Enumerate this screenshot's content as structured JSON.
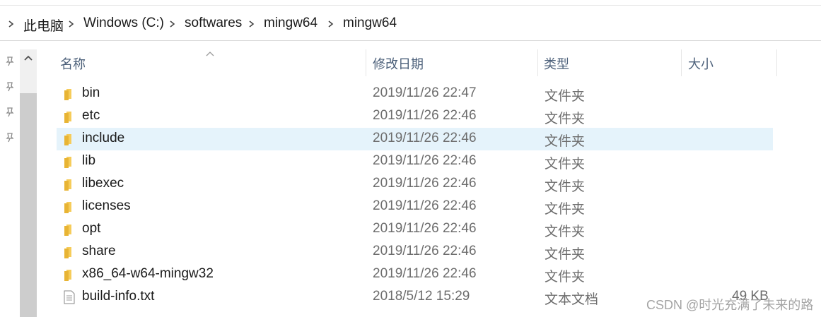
{
  "breadcrumb": {
    "items": [
      "此电脑",
      "Windows (C:)",
      "softwares",
      "mingw64",
      "mingw64"
    ]
  },
  "columns": {
    "name": "名称",
    "date": "修改日期",
    "type": "类型",
    "size": "大小"
  },
  "files": [
    {
      "name": "bin",
      "date": "2019/11/26 22:47",
      "type": "文件夹",
      "size": "",
      "icon": "folder-icon"
    },
    {
      "name": "etc",
      "date": "2019/11/26 22:46",
      "type": "文件夹",
      "size": "",
      "icon": "folder-icon"
    },
    {
      "name": "include",
      "date": "2019/11/26 22:46",
      "type": "文件夹",
      "size": "",
      "icon": "folder-icon",
      "selected": true
    },
    {
      "name": "lib",
      "date": "2019/11/26 22:46",
      "type": "文件夹",
      "size": "",
      "icon": "folder-icon"
    },
    {
      "name": "libexec",
      "date": "2019/11/26 22:46",
      "type": "文件夹",
      "size": "",
      "icon": "folder-icon"
    },
    {
      "name": "licenses",
      "date": "2019/11/26 22:46",
      "type": "文件夹",
      "size": "",
      "icon": "folder-icon"
    },
    {
      "name": "opt",
      "date": "2019/11/26 22:46",
      "type": "文件夹",
      "size": "",
      "icon": "folder-icon"
    },
    {
      "name": "share",
      "date": "2019/11/26 22:46",
      "type": "文件夹",
      "size": "",
      "icon": "folder-icon"
    },
    {
      "name": "x86_64-w64-mingw32",
      "date": "2019/11/26 22:46",
      "type": "文件夹",
      "size": "",
      "icon": "folder-icon"
    },
    {
      "name": "build-info.txt",
      "date": "2018/5/12 15:29",
      "type": "文本文档",
      "size": "49 KB",
      "icon": "text-file-icon"
    }
  ],
  "watermark": "CSDN @时光充满了未来的路",
  "colors": {
    "selection": "#e5f3fb",
    "header_text": "#4c607a",
    "folder": "#e8b434"
  }
}
